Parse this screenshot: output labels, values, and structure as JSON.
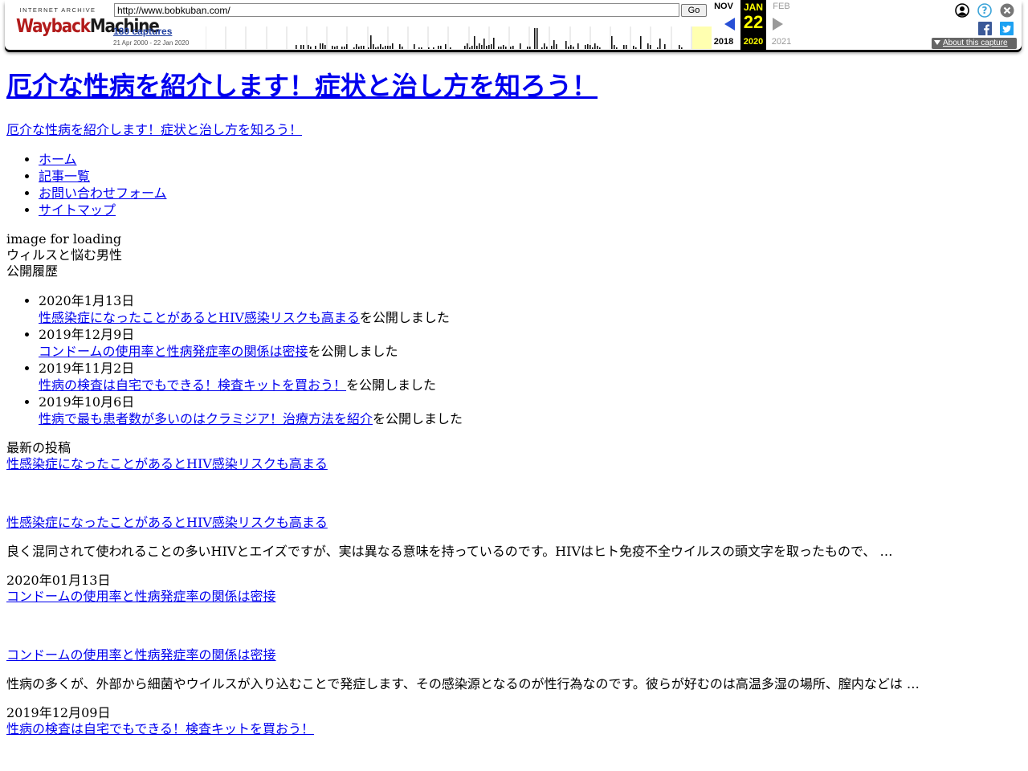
{
  "toolbar": {
    "logo_top": "INTERNET ARCHIVE",
    "logo_main_a": "Wayback",
    "logo_main_b": "Machine",
    "url": "http://www.bobkuban.com/",
    "go_label": "Go",
    "captures_label": "180 captures",
    "date_range": "21 Apr 2000 - 22 Jan 2020",
    "prev_month": "NOV",
    "prev_year": "2018",
    "cur_month": "JAN",
    "cur_day": "22",
    "cur_year": "2020",
    "next_month": "FEB",
    "next_year": "2021",
    "about_label": "About this capture",
    "accent_prev": "#2850d6",
    "accent_highlight": "#ffff00"
  },
  "site": {
    "title": "厄介な性病を紹介します！症状と治し方を知ろう！",
    "description": "厄介な性病を紹介します！症状と治し方を知ろう！",
    "nav": [
      "ホーム",
      "記事一覧",
      "お問い合わせフォーム",
      "サイトマップ"
    ],
    "img_loading_alt": "image for loading",
    "img_hero_alt": "ウィルスと悩む男性",
    "history_heading": "公開履歴",
    "history_suffix": "を公開しました",
    "history": [
      {
        "date": "2020年1月13日",
        "title": "性感染症になったことがあるとHIV感染リスクも高まる"
      },
      {
        "date": "2019年12月9日",
        "title": "コンドームの使用率と性病発症率の関係は密接"
      },
      {
        "date": "2019年11月2日",
        "title": "性病の検査は自宅でもできる！検査キットを買おう！"
      },
      {
        "date": "2019年10月6日",
        "title": "性病で最も患者数が多いのはクラミジア！治療方法を紹介"
      }
    ],
    "latest_heading": "最新の投稿",
    "posts": [
      {
        "title": "性感染症になったことがあるとHIV感染リスクも高まる",
        "excerpt": "良く混同されて使われることの多いHIVとエイズですが、実は異なる意味を持っているのです。HIVはヒト免疫不全ウイルスの頭文字を取ったもので、 …",
        "date": "2020年01月13日"
      },
      {
        "title": "コンドームの使用率と性病発症率の関係は密接",
        "excerpt": "性病の多くが、外部から細菌やウイルスが入り込むことで発症します、その感染源となるのが性行為なのです。彼らが好むのは高温多湿の場所、膣内などは …",
        "date": "2019年12月09日"
      },
      {
        "title": "性病の検査は自宅でもできる！検査キットを買おう！"
      }
    ]
  }
}
